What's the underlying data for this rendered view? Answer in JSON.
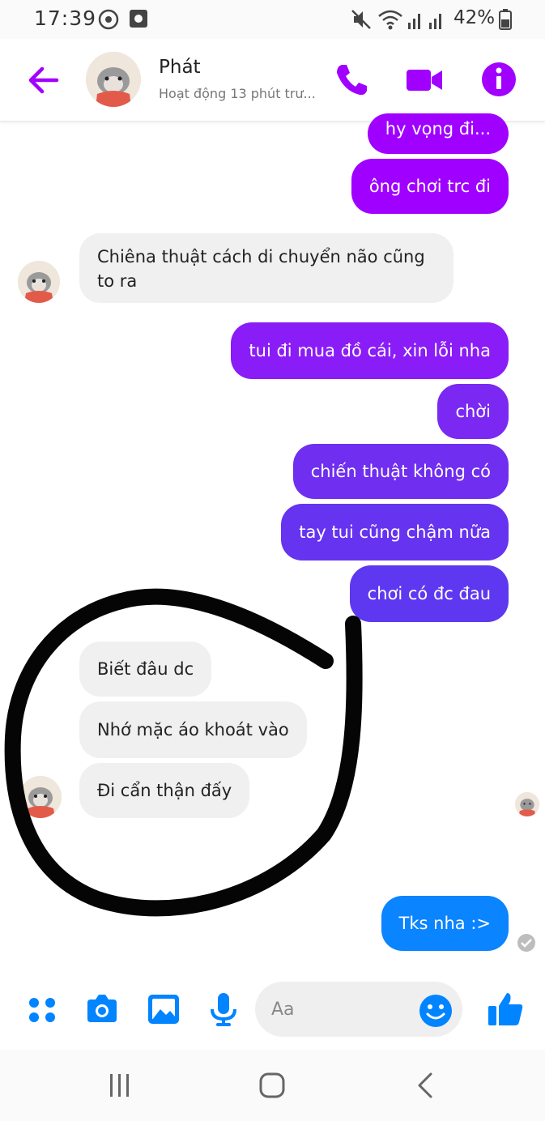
{
  "status_bar": {
    "time": "17:39",
    "battery": "42%"
  },
  "header": {
    "contact_name": "Phát",
    "contact_status": "Hoạt động 13 phút trư..."
  },
  "messages": [
    {
      "id": "m1",
      "direction": "outgoing",
      "text": "hy vọng đi..."
    },
    {
      "id": "m2",
      "direction": "outgoing",
      "text": "ông chơi trc đi"
    },
    {
      "id": "m3",
      "direction": "incoming",
      "text": "Chiêna thuật cách di chuyển não cũng",
      "text2": "to ra"
    },
    {
      "id": "m4",
      "direction": "outgoing",
      "text": "tui đi mua đồ cái, xin lỗi nha"
    },
    {
      "id": "m5",
      "direction": "outgoing",
      "text": "chời"
    },
    {
      "id": "m6",
      "direction": "outgoing",
      "text": "chiến thuật không có"
    },
    {
      "id": "m7",
      "direction": "outgoing",
      "text": "tay tui cũng chậm nữa"
    },
    {
      "id": "m8",
      "direction": "outgoing",
      "text": "chơi có đc đau"
    },
    {
      "id": "m9",
      "direction": "incoming",
      "text": "Biết đâu dc"
    },
    {
      "id": "m10",
      "direction": "incoming",
      "text": "Nhớ mặc áo khoát vào"
    },
    {
      "id": "m11",
      "direction": "incoming",
      "text": "Đi cẩn thận đấy"
    },
    {
      "id": "m12",
      "direction": "outgoing",
      "text": "Tks nha :>"
    }
  ],
  "composer": {
    "placeholder": "Aa"
  },
  "colors": {
    "accent": "#a100ff",
    "gradient_top": "#a000ff",
    "gradient_mid": "#6a2cf0",
    "last_bubble": "#0a84ff",
    "composer_icons": "#0084ff",
    "incoming_bg": "#f0f0f0"
  },
  "icons": {
    "status": [
      "play-circle-icon",
      "image-notification-icon",
      "mute-icon",
      "wifi-icon",
      "signal-icon",
      "battery-icon"
    ],
    "header": [
      "back-arrow-icon",
      "phone-icon",
      "video-icon",
      "info-icon"
    ],
    "composer": [
      "apps-icon",
      "camera-icon",
      "gallery-icon",
      "microphone-icon",
      "emoji-icon",
      "thumbs-up-icon"
    ],
    "nav": [
      "recent-apps-icon",
      "home-icon",
      "back-icon"
    ]
  }
}
